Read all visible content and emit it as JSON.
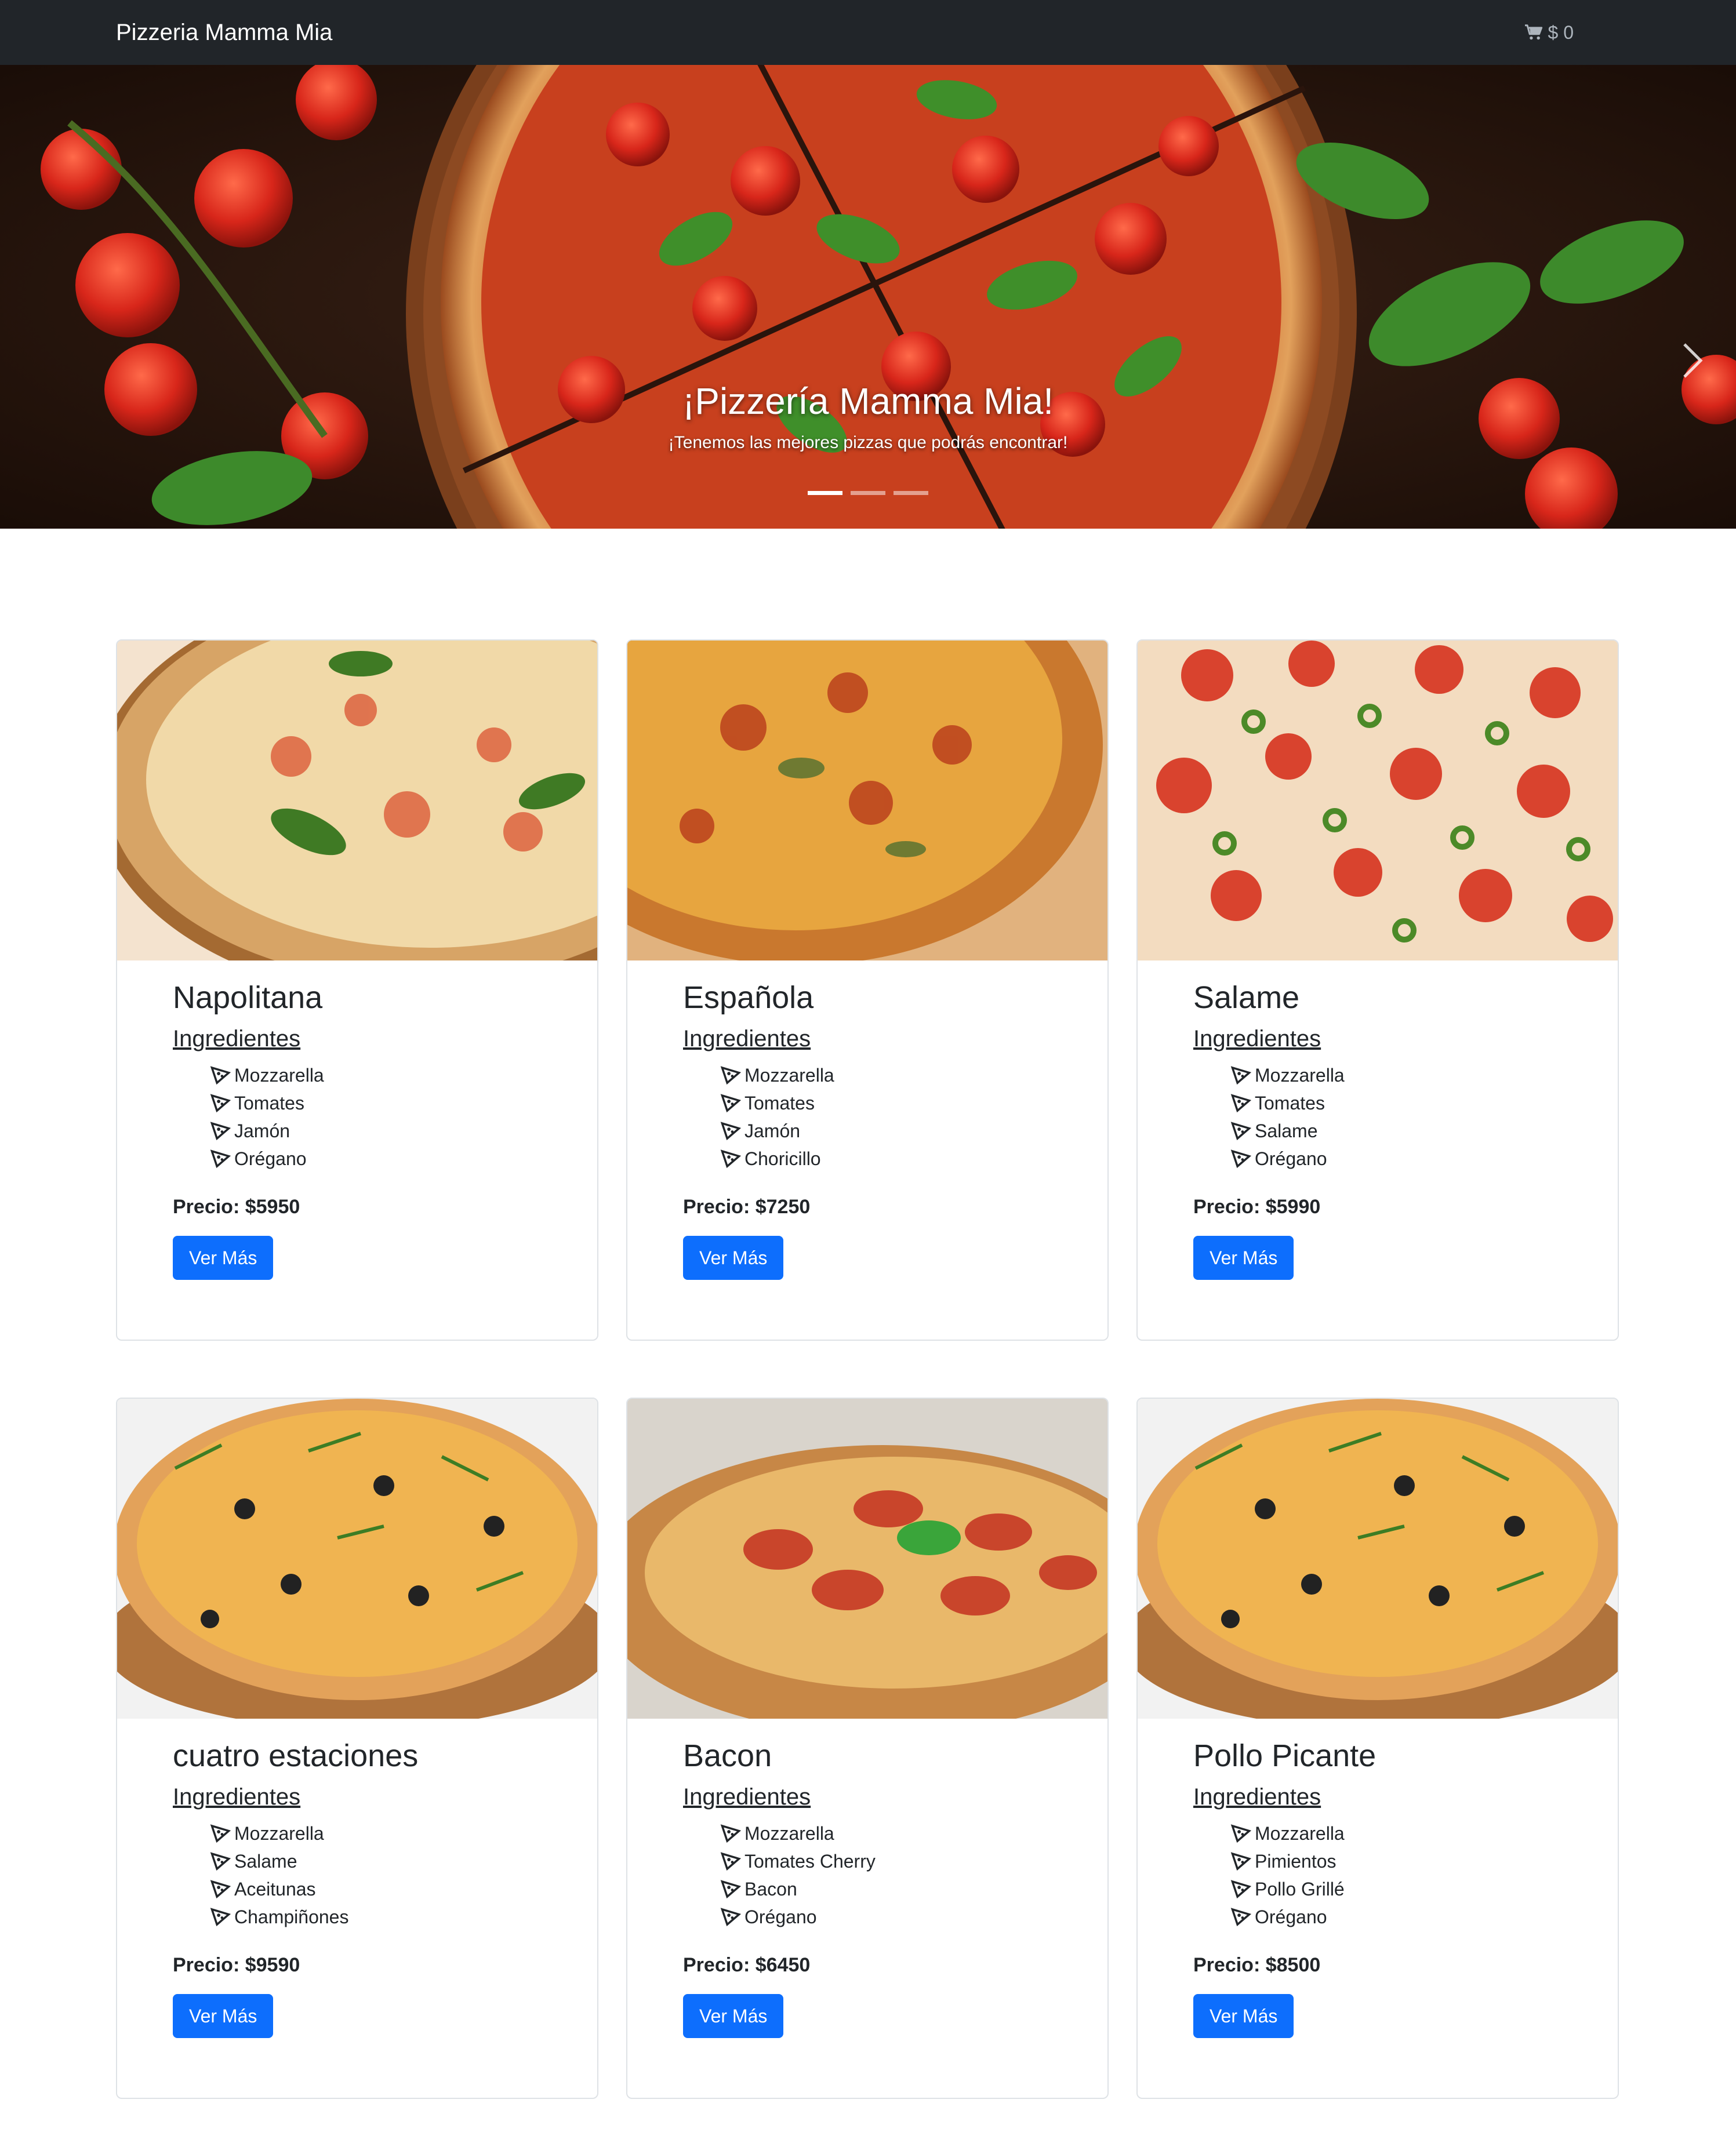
{
  "navbar": {
    "brand": "Pizzeria Mamma Mia",
    "cart_total": "$ 0",
    "cart_icon": "shopping-cart-icon"
  },
  "hero": {
    "title": "¡Pizzería Mamma Mia!",
    "subtitle": "¡Tenemos las mejores pizzas que podrás encontrar!",
    "slides": 3,
    "active_slide": 1,
    "next_icon": "chevron-right-icon"
  },
  "pizzas": [
    {
      "name": "Napolitana",
      "ingredients_label": "Ingredientes",
      "ingredients": [
        "Mozzarella",
        "Tomates",
        "Jamón",
        "Orégano"
      ],
      "price": "Precio: $5950",
      "button": "Ver Más"
    },
    {
      "name": "Española",
      "ingredients_label": "Ingredientes",
      "ingredients": [
        "Mozzarella",
        "Tomates",
        "Jamón",
        "Choricillo"
      ],
      "price": "Precio: $7250",
      "button": "Ver Más"
    },
    {
      "name": "Salame",
      "ingredients_label": "Ingredientes",
      "ingredients": [
        "Mozzarella",
        "Tomates",
        "Salame",
        "Orégano"
      ],
      "price": "Precio: $5990",
      "button": "Ver Más"
    },
    {
      "name": "cuatro estaciones",
      "ingredients_label": "Ingredientes",
      "ingredients": [
        "Mozzarella",
        "Salame",
        "Aceitunas",
        "Champiñones"
      ],
      "price": "Precio: $9590",
      "button": "Ver Más"
    },
    {
      "name": "Bacon",
      "ingredients_label": "Ingredientes",
      "ingredients": [
        "Mozzarella",
        "Tomates Cherry",
        "Bacon",
        "Orégano"
      ],
      "price": "Precio: $6450",
      "button": "Ver Más"
    },
    {
      "name": "Pollo Picante",
      "ingredients_label": "Ingredientes",
      "ingredients": [
        "Mozzarella",
        "Pimientos",
        "Pollo Grillé",
        "Orégano"
      ],
      "price": "Precio: $8500",
      "button": "Ver Más"
    }
  ],
  "colors": {
    "navbar": "#212529",
    "primary": "#0d6efd",
    "border": "#dee2e6"
  }
}
